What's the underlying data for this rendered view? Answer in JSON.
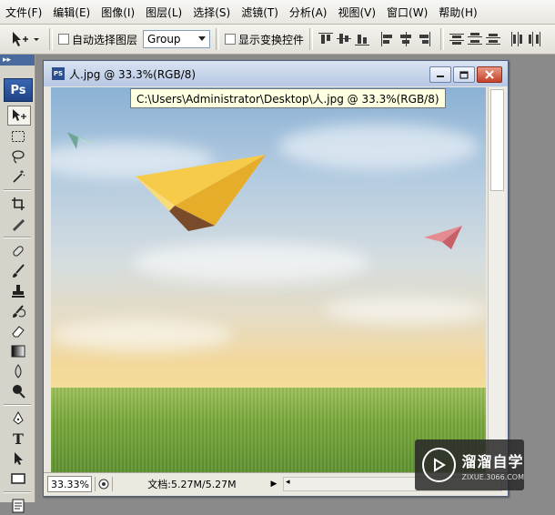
{
  "menu": [
    "文件(F)",
    "编辑(E)",
    "图像(I)",
    "图层(L)",
    "选择(S)",
    "滤镜(T)",
    "分析(A)",
    "视图(V)",
    "窗口(W)",
    "帮助(H)"
  ],
  "options": {
    "auto_select_label": "自动选择图层",
    "group_value": "Group",
    "show_transform_label": "显示变换控件"
  },
  "toolbox": {
    "grip": "▸▸",
    "logo": "Ps"
  },
  "document": {
    "icon": "PS",
    "title": "人.jpg @ 33.3%(RGB/8)",
    "tooltip": "C:\\Users\\Administrator\\Desktop\\人.jpg @ 33.3%(RGB/8)",
    "zoom": "33.33%",
    "doc_info": "文档:5.27M/5.27M"
  },
  "watermark": {
    "main": "溜溜自学",
    "sub": "ZIXUE.3066.COM"
  },
  "icons": {
    "move_tool": "move-tool-icon",
    "minimize": "minimize-icon",
    "maximize": "maximize-icon",
    "close": "close-icon"
  }
}
